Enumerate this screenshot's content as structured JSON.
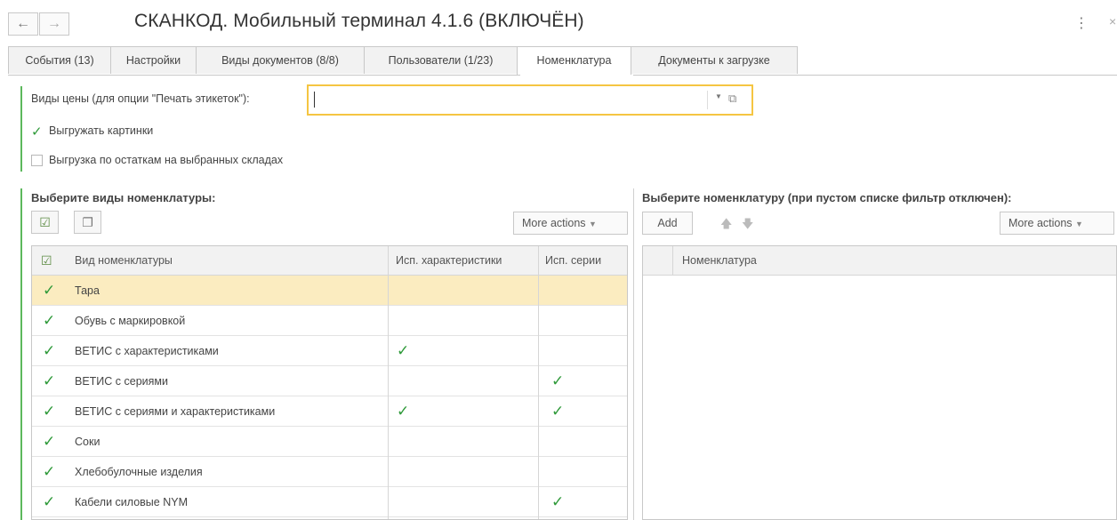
{
  "header": {
    "back_label": "←",
    "forward_label": "→",
    "title": "СКАНКОД. Мобильный терминал 4.1.6 (ВКЛЮЧЁН)",
    "more_label": "⋮",
    "close_label": "×"
  },
  "tabs": [
    {
      "label": "События (13)"
    },
    {
      "label": "Настройки"
    },
    {
      "label": "Виды документов (8/8)"
    },
    {
      "label": "Пользователи (1/23)"
    },
    {
      "label": "Номенклатура"
    },
    {
      "label": "Документы к загрузке"
    }
  ],
  "active_tab": "Номенклатура",
  "form": {
    "price_label": "Виды цены (для опции \"Печать этикеток\"):",
    "price_value": "",
    "export_images_label": "Выгружать картинки",
    "export_images_checked": true,
    "export_stock_label": "Выгрузка по остаткам на выбранных складах",
    "export_stock_checked": false
  },
  "left": {
    "section_title": "Выберите виды номенклатуры:",
    "more_actions": "More actions",
    "columns": [
      "Вид номенклатуры",
      "Исп. характеристики",
      "Исп. серии"
    ],
    "rows": [
      {
        "checked": true,
        "name": "Тара",
        "chars": false,
        "series": false,
        "selected": true
      },
      {
        "checked": true,
        "name": "Обувь с маркировкой",
        "chars": false,
        "series": false
      },
      {
        "checked": true,
        "name": "ВЕТИС с характеристиками",
        "chars": true,
        "series": false
      },
      {
        "checked": true,
        "name": "ВЕТИС с сериями",
        "chars": false,
        "series": true
      },
      {
        "checked": true,
        "name": "ВЕТИС с сериями и характеристиками",
        "chars": true,
        "series": true
      },
      {
        "checked": true,
        "name": "Соки",
        "chars": false,
        "series": false
      },
      {
        "checked": true,
        "name": "Хлебобулочные изделия",
        "chars": false,
        "series": false
      },
      {
        "checked": true,
        "name": "Кабели силовые NYM",
        "chars": false,
        "series": true
      }
    ]
  },
  "right": {
    "section_title": "Выберите номенклатуру (при пустом списке фильтр отключен):",
    "add_label": "Add",
    "more_actions": "More actions",
    "columns": [
      "Номенклатура"
    ]
  },
  "colors": {
    "accent_green": "#5cb85c",
    "check_green": "#2f9a3a",
    "selection": "#fbecc0",
    "focus_border": "#f5c542"
  }
}
